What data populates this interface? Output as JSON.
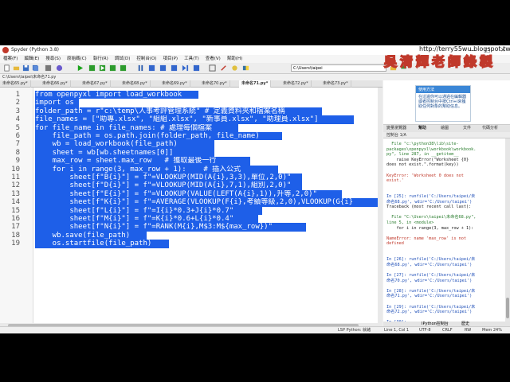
{
  "window": {
    "title": "Spyder (Python 3.8)",
    "controls": [
      "—",
      "□",
      "✕"
    ]
  },
  "menu": [
    "檔案(F)",
    "編輯(E)",
    "搜尋(S)",
    "原始碼(C)",
    "執行(R)",
    "調試(D)",
    "控制台(O)",
    "項目(P)",
    "工具(T)",
    "查看(V)",
    "幫助(H)"
  ],
  "toolbar": {
    "path_value": "C:\\Users\\taipei"
  },
  "path_bar": "C:\\Users\\taipei\\未命名71.py",
  "tabs": [
    "未命名65.py*",
    "未命名66.py*",
    "未命名67.py*",
    "未命名68.py*",
    "未命名69.py*",
    "未命名70.py*",
    "未命名71.py*",
    "未命名72.py*",
    "未命名73.py*"
  ],
  "active_tab_index": 6,
  "editor": {
    "line_numbers": [
      "1",
      "2",
      "3",
      "4",
      "5",
      "6",
      "7",
      "8",
      "9",
      "10",
      "11",
      "12",
      "13",
      "14",
      "15",
      "16",
      "17",
      "18",
      "19"
    ],
    "lines": [
      "from openpyxl import load_workbook",
      "import os",
      "folder_path = r\"c:\\temp\\人事考評管理系統\" # 定義資料夾和檔案名稱",
      "file_names = [\"助專.xlsx\", \"組組.xlsx\", \"新事員.xlsx\", \"助理員.xlsx\"]",
      "for file_name in file_names: # 處理每個檔案",
      "    file_path = os.path.join(folder_path, file_name)",
      "    wb = load_workbook(file_path)",
      "    sheet = wb[wb.sheetnames[0]]",
      "    max_row = sheet.max_row   # 獲取最後一行",
      "    for i in range(3, max_row + 1):    # 插入公式",
      "        sheet[f\"B{i}\"] = f\"=VLOOKUP(MID(A{i},3,3),單位,2,0)\"",
      "        sheet[f\"D{i}\"] = f\"=VLOOKUP(MID(A{i},7,1),組別,2,0)\"",
      "        sheet[f\"E{i}\"] = f\"=VLOOKUP(VALUE(LEFT(A{i},1)),升等,2,0)\"",
      "        sheet[f\"K{i}\"] = f\"=AVERAGE(VLOOKUP(F{i},考績等級,2,0),VLOOKUP(G{i}",
      "        sheet[f\"L{i}\"] = f\"=I{i}*0.3+J{i}*0.7\"",
      "        sheet[f\"M{i}\"] = f\"=K{i}*0.6+L{i}*0.4\"",
      "        sheet[f\"N{i}\"] = f\"=RANK(M{i},M$3:M${max_row})\"",
      "    wb.save(file_path)",
      "    os.startfile(file_path)"
    ]
  },
  "help_panel": {
    "card_title": "使用方法",
    "card_body": "在這邊你可以通過在編輯器或者控制台中按Ctrl+I來獲取任何對象的幫助信息。"
  },
  "right_tabs": [
    "變量瀏覽器",
    "幫助",
    "繪圖",
    "文件",
    "代碼分析"
  ],
  "console_tab": "控制台 1/A",
  "console_lines": [
    {
      "t": "  File \"c:\\python38\\lib\\site-",
      "c": "grn"
    },
    {
      "t": "packages\\openpyxl\\workbook\\workbook.",
      "c": "grn"
    },
    {
      "t": "py\", line 287, in __getitem__",
      "c": "grn"
    },
    {
      "t": "    raise KeyError(\"Worksheet {0}",
      "c": ""
    },
    {
      "t": "does not exist.\".format(key))",
      "c": ""
    },
    {
      "t": "",
      "c": ""
    },
    {
      "t": "KeyError: 'Worksheet 0 does not",
      "c": "red"
    },
    {
      "t": "exist.'",
      "c": "red"
    },
    {
      "t": "",
      "c": ""
    },
    {
      "t": "",
      "c": ""
    },
    {
      "t": "In [25]: runfile('C:/Users/taipei/未",
      "c": "blu"
    },
    {
      "t": "命名68.py', wdir='C:/Users/taipei')",
      "c": "blu"
    },
    {
      "t": "Traceback (most recent call last):",
      "c": ""
    },
    {
      "t": "",
      "c": ""
    },
    {
      "t": "  File \"C:\\Users\\taipei\\未命名68.py\",",
      "c": "grn"
    },
    {
      "t": "line 5, in <module>",
      "c": "grn"
    },
    {
      "t": "    for i in range(3, max_row + 1):",
      "c": ""
    },
    {
      "t": "",
      "c": ""
    },
    {
      "t": "NameError: name 'max_row' is not",
      "c": "red"
    },
    {
      "t": "defined",
      "c": "red"
    },
    {
      "t": "",
      "c": ""
    },
    {
      "t": "",
      "c": ""
    },
    {
      "t": "In [26]: runfile('C:/Users/taipei/未",
      "c": "blu"
    },
    {
      "t": "命名68.py', wdir='C:/Users/taipei')",
      "c": "blu"
    },
    {
      "t": "",
      "c": ""
    },
    {
      "t": "In [27]: runfile('C:/Users/taipei/未",
      "c": "blu"
    },
    {
      "t": "命名70.py', wdir='C:/Users/taipei')",
      "c": "blu"
    },
    {
      "t": "",
      "c": ""
    },
    {
      "t": "In [28]: runfile('C:/Users/taipei/未",
      "c": "blu"
    },
    {
      "t": "命名71.py', wdir='C:/Users/taipei')",
      "c": "blu"
    },
    {
      "t": "",
      "c": ""
    },
    {
      "t": "In [29]: runfile('C:/Users/taipei/未",
      "c": "blu"
    },
    {
      "t": "命名72.py', wdir='C:/Users/taipei')",
      "c": "blu"
    },
    {
      "t": "",
      "c": ""
    },
    {
      "t": "In [30]:",
      "c": "blu"
    }
  ],
  "right_bottom_tabs": [
    "IPython控制台",
    "歷史"
  ],
  "status": {
    "lsp": "LSP Python: 就緒",
    "position": "Line 1, Col 1",
    "encoding": "UTF-8",
    "eol": "CRLF",
    "rw": "RW",
    "mem": "Mem 24%"
  },
  "overlay": {
    "blog_url": "http://terry55wu.blogspot.tw",
    "stamp": "吳清輝老師錄製"
  },
  "colors": {
    "selection": "#1e5fe8",
    "accent_red": "#c0392b"
  }
}
